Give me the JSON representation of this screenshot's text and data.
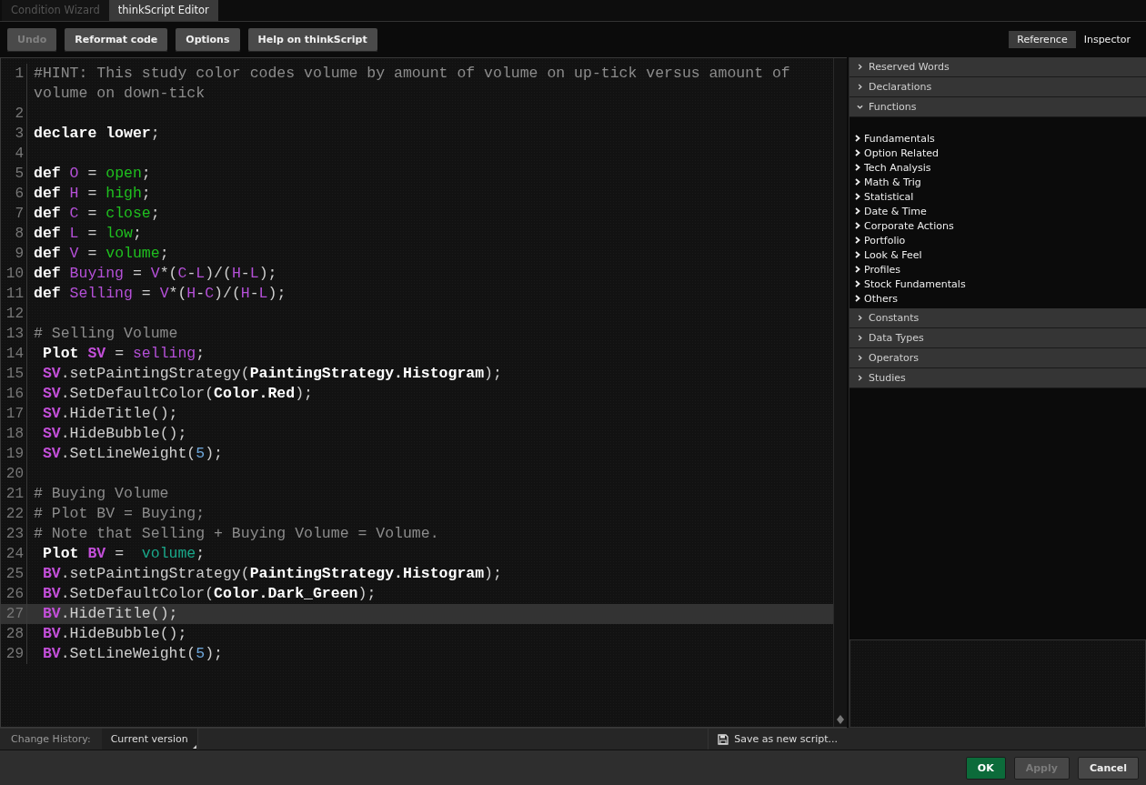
{
  "tabs": [
    {
      "label": "Condition Wizard",
      "selected": false
    },
    {
      "label": "thinkScript Editor",
      "selected": true
    }
  ],
  "toolbar": {
    "buttons": [
      {
        "label": "Undo",
        "disabled": true
      },
      {
        "label": "Reformat code",
        "disabled": false
      },
      {
        "label": "Options",
        "disabled": false
      },
      {
        "label": "Help on thinkScript",
        "disabled": false
      }
    ]
  },
  "side_tabs": [
    {
      "label": "Reference",
      "selected": true
    },
    {
      "label": "Inspector",
      "selected": false
    }
  ],
  "editor": {
    "lines": [
      {
        "number": "1",
        "current": false,
        "tokens": [
          {
            "kind": "comment",
            "text": "#HINT: This study color codes volume by amount of volume on up-tick versus amount of volume on down-tick"
          }
        ]
      },
      {
        "number": "2",
        "current": false
      },
      {
        "number": "3",
        "current": false,
        "tokens": [
          {
            "kind": "kw",
            "text": "declare lower"
          },
          {
            "kind": "op",
            "text": ";"
          }
        ]
      },
      {
        "number": "4",
        "current": false
      },
      {
        "number": "5",
        "current": false,
        "tokens": [
          {
            "kind": "kw",
            "text": "def "
          },
          {
            "kind": "var",
            "text": "O"
          },
          {
            "kind": "op",
            "text": " = "
          },
          {
            "kind": "func",
            "text": "open"
          },
          {
            "kind": "op",
            "text": ";"
          }
        ]
      },
      {
        "number": "6",
        "current": false,
        "tokens": [
          {
            "kind": "kw",
            "text": "def "
          },
          {
            "kind": "var",
            "text": "H"
          },
          {
            "kind": "op",
            "text": " = "
          },
          {
            "kind": "func",
            "text": "high"
          },
          {
            "kind": "op",
            "text": ";"
          }
        ]
      },
      {
        "number": "7",
        "current": false,
        "tokens": [
          {
            "kind": "kw",
            "text": "def "
          },
          {
            "kind": "var",
            "text": "C"
          },
          {
            "kind": "op",
            "text": " = "
          },
          {
            "kind": "func",
            "text": "close"
          },
          {
            "kind": "op",
            "text": ";"
          }
        ]
      },
      {
        "number": "8",
        "current": false,
        "tokens": [
          {
            "kind": "kw",
            "text": "def "
          },
          {
            "kind": "var",
            "text": "L"
          },
          {
            "kind": "op",
            "text": " = "
          },
          {
            "kind": "func",
            "text": "low"
          },
          {
            "kind": "op",
            "text": ";"
          }
        ]
      },
      {
        "number": "9",
        "current": false,
        "tokens": [
          {
            "kind": "kw",
            "text": "def "
          },
          {
            "kind": "var",
            "text": "V"
          },
          {
            "kind": "op",
            "text": " = "
          },
          {
            "kind": "func",
            "text": "volume"
          },
          {
            "kind": "op",
            "text": ";"
          }
        ]
      },
      {
        "number": "10",
        "current": false,
        "tokens": [
          {
            "kind": "kw",
            "text": "def "
          },
          {
            "kind": "var",
            "text": "Buying"
          },
          {
            "kind": "op",
            "text": " = "
          },
          {
            "kind": "var",
            "text": "V"
          },
          {
            "kind": "op",
            "text": "*("
          },
          {
            "kind": "var",
            "text": "C"
          },
          {
            "kind": "op",
            "text": "-"
          },
          {
            "kind": "var",
            "text": "L"
          },
          {
            "kind": "op",
            "text": ")/("
          },
          {
            "kind": "var",
            "text": "H"
          },
          {
            "kind": "op",
            "text": "-"
          },
          {
            "kind": "var",
            "text": "L"
          },
          {
            "kind": "op",
            "text": ");"
          }
        ]
      },
      {
        "number": "11",
        "current": false,
        "tokens": [
          {
            "kind": "kw",
            "text": "def "
          },
          {
            "kind": "var",
            "text": "Selling"
          },
          {
            "kind": "op",
            "text": " = "
          },
          {
            "kind": "var",
            "text": "V"
          },
          {
            "kind": "op",
            "text": "*("
          },
          {
            "kind": "var",
            "text": "H"
          },
          {
            "kind": "op",
            "text": "-"
          },
          {
            "kind": "var",
            "text": "C"
          },
          {
            "kind": "op",
            "text": ")/("
          },
          {
            "kind": "var",
            "text": "H"
          },
          {
            "kind": "op",
            "text": "-"
          },
          {
            "kind": "var",
            "text": "L"
          },
          {
            "kind": "op",
            "text": ");"
          }
        ]
      },
      {
        "number": "12",
        "current": false
      },
      {
        "number": "13",
        "current": false,
        "tokens": [
          {
            "kind": "comment",
            "text": "# Selling Volume"
          }
        ]
      },
      {
        "number": "14",
        "current": false,
        "tokens": [
          {
            "kind": "kw",
            "text": " Plot "
          },
          {
            "kind": "varb",
            "text": "SV"
          },
          {
            "kind": "op",
            "text": " = "
          },
          {
            "kind": "var",
            "text": "selling"
          },
          {
            "kind": "op",
            "text": ";"
          }
        ]
      },
      {
        "number": "15",
        "current": false,
        "tokens": [
          {
            "kind": "varb",
            "text": " SV"
          },
          {
            "kind": "op",
            "text": ".setPaintingStrategy("
          },
          {
            "kind": "kw",
            "text": "PaintingStrategy.Histogram"
          },
          {
            "kind": "op",
            "text": ");"
          }
        ]
      },
      {
        "number": "16",
        "current": false,
        "tokens": [
          {
            "kind": "varb",
            "text": " SV"
          },
          {
            "kind": "op",
            "text": ".SetDefaultColor("
          },
          {
            "kind": "kw",
            "text": "Color.Red"
          },
          {
            "kind": "op",
            "text": ");"
          }
        ]
      },
      {
        "number": "17",
        "current": false,
        "tokens": [
          {
            "kind": "varb",
            "text": " SV"
          },
          {
            "kind": "op",
            "text": ".HideTitle();"
          }
        ]
      },
      {
        "number": "18",
        "current": false,
        "tokens": [
          {
            "kind": "varb",
            "text": " SV"
          },
          {
            "kind": "op",
            "text": ".HideBubble();"
          }
        ]
      },
      {
        "number": "19",
        "current": false,
        "tokens": [
          {
            "kind": "varb",
            "text": " SV"
          },
          {
            "kind": "op",
            "text": ".SetLineWeight("
          },
          {
            "kind": "num",
            "text": "5"
          },
          {
            "kind": "op",
            "text": ");"
          }
        ]
      },
      {
        "number": "20",
        "current": false
      },
      {
        "number": "21",
        "current": false,
        "tokens": [
          {
            "kind": "comment",
            "text": "# Buying Volume"
          }
        ]
      },
      {
        "number": "22",
        "current": false,
        "tokens": [
          {
            "kind": "comment",
            "text": "# Plot BV = Buying;"
          }
        ]
      },
      {
        "number": "23",
        "current": false,
        "tokens": [
          {
            "kind": "comment",
            "text": "# Note that Selling + Buying Volume = Volume."
          }
        ]
      },
      {
        "number": "24",
        "current": false,
        "tokens": [
          {
            "kind": "kw",
            "text": " Plot "
          },
          {
            "kind": "varb",
            "text": "BV"
          },
          {
            "kind": "op",
            "text": " =  "
          },
          {
            "kind": "data",
            "text": "volume"
          },
          {
            "kind": "op",
            "text": ";"
          }
        ]
      },
      {
        "number": "25",
        "current": false,
        "tokens": [
          {
            "kind": "varb",
            "text": " BV"
          },
          {
            "kind": "op",
            "text": ".setPaintingStrategy("
          },
          {
            "kind": "kw",
            "text": "PaintingStrategy.Histogram"
          },
          {
            "kind": "op",
            "text": ");"
          }
        ]
      },
      {
        "number": "26",
        "current": false,
        "tokens": [
          {
            "kind": "varb",
            "text": " BV"
          },
          {
            "kind": "op",
            "text": ".SetDefaultColor("
          },
          {
            "kind": "kw",
            "text": "Color.Dark_Green"
          },
          {
            "kind": "op",
            "text": ");"
          }
        ]
      },
      {
        "number": "27",
        "current": true,
        "tokens": [
          {
            "kind": "varb",
            "text": " BV"
          },
          {
            "kind": "op",
            "text": ".HideTitle();"
          }
        ]
      },
      {
        "number": "28",
        "current": false,
        "tokens": [
          {
            "kind": "varb",
            "text": " BV"
          },
          {
            "kind": "op",
            "text": ".HideBubble();"
          }
        ]
      },
      {
        "number": "29",
        "current": false,
        "tokens": [
          {
            "kind": "varb",
            "text": " BV"
          },
          {
            "kind": "op",
            "text": ".SetLineWeight("
          },
          {
            "kind": "num",
            "text": "5"
          },
          {
            "kind": "op",
            "text": ");"
          }
        ]
      }
    ]
  },
  "reference": {
    "sections": [
      {
        "label": "Reserved Words",
        "expanded": false
      },
      {
        "label": "Declarations",
        "expanded": false
      },
      {
        "label": "Functions",
        "expanded": true,
        "children": [
          "Fundamentals",
          "Option Related",
          "Tech Analysis",
          "Math & Trig",
          "Statistical",
          "Date & Time",
          "Corporate Actions",
          "Portfolio",
          "Look & Feel",
          "Profiles",
          "Stock Fundamentals",
          "Others"
        ]
      },
      {
        "label": "Constants",
        "expanded": false
      },
      {
        "label": "Data Types",
        "expanded": false
      },
      {
        "label": "Operators",
        "expanded": false
      },
      {
        "label": "Studies",
        "expanded": false
      }
    ]
  },
  "change_history": {
    "label": "Change History:",
    "value": "Current version"
  },
  "save_button": "Save as new script...",
  "footer_buttons": [
    {
      "label": "OK",
      "kind": "primary",
      "disabled": false
    },
    {
      "label": "Apply",
      "kind": "normal",
      "disabled": true
    },
    {
      "label": "Cancel",
      "kind": "normal",
      "disabled": false
    }
  ]
}
